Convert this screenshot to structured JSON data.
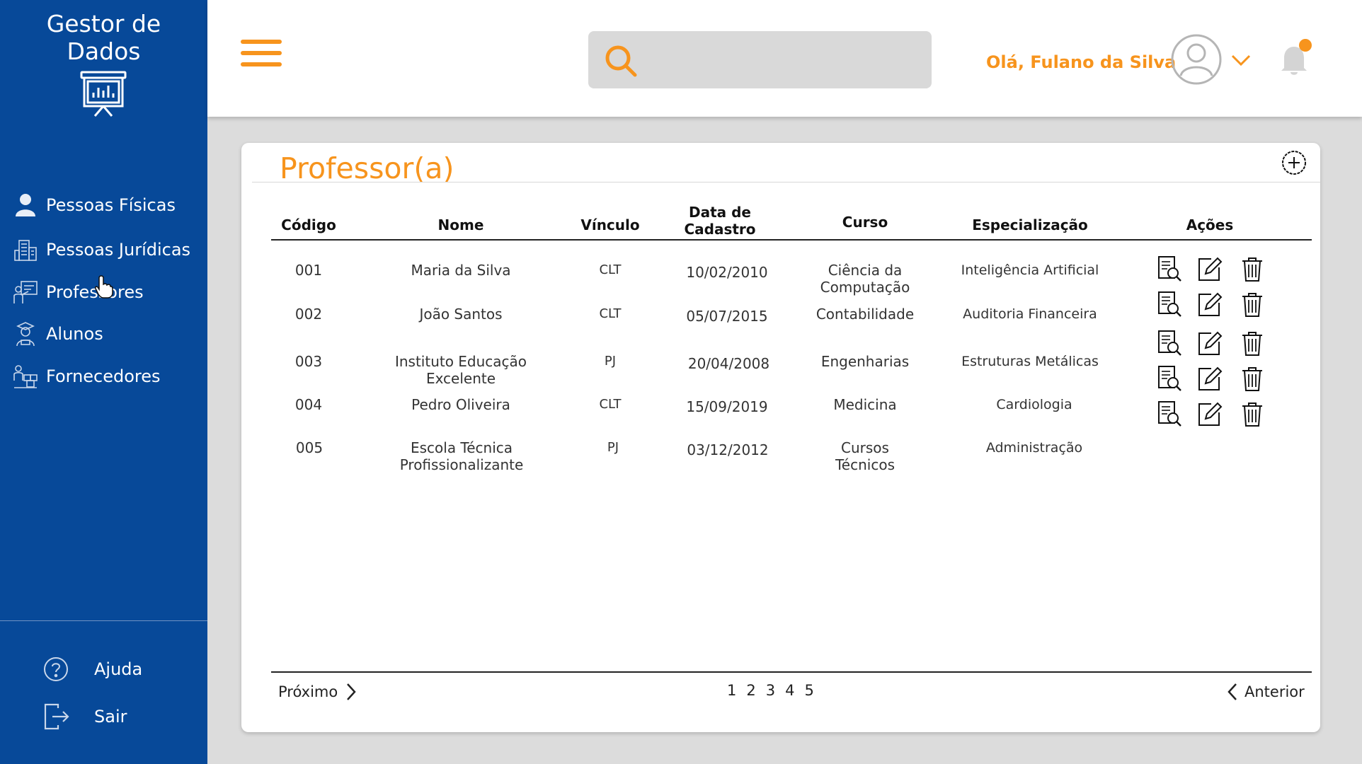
{
  "sidebar": {
    "brand": "Gestor de Dados",
    "items": [
      {
        "label": "Pessoas Físicas",
        "icon": "person-icon"
      },
      {
        "label": "Pessoas Jurídicas",
        "icon": "building-icon"
      },
      {
        "label": "Professores",
        "icon": "teacher-board-icon"
      },
      {
        "label": "Alunos",
        "icon": "student-icon"
      },
      {
        "label": "Fornecedores",
        "icon": "supplier-icon"
      }
    ],
    "bottom": [
      {
        "label": "Ajuda",
        "icon": "help-icon"
      },
      {
        "label": "Sair",
        "icon": "logout-icon"
      }
    ]
  },
  "header": {
    "search": {
      "placeholder": "",
      "value": ""
    },
    "greeting": "Olá, Fulano da Silva"
  },
  "card": {
    "title": "Professor(a)",
    "columns": [
      "Código",
      "Nome",
      "Vínculo",
      "Data de Cadastro",
      "Curso",
      "Especialização",
      "Ações"
    ],
    "rows": [
      {
        "codigo": "001",
        "nome": "Maria da Silva",
        "vinculo": "CLT",
        "data": "10/02/2010",
        "curso": "Ciência da Computação",
        "especializacao": "Inteligência Artificial"
      },
      {
        "codigo": "002",
        "nome": "João Santos",
        "vinculo": "CLT",
        "data": "05/07/2015",
        "curso": "Contabilidade",
        "especializacao": "Auditoria Financeira"
      },
      {
        "codigo": "003",
        "nome": "Instituto Educação Excelente",
        "vinculo": "PJ",
        "data": "20/04/2008",
        "curso": "Engenharias",
        "especializacao": "Estruturas Metálicas"
      },
      {
        "codigo": "004",
        "nome": "Pedro Oliveira",
        "vinculo": "CLT",
        "data": "15/09/2019",
        "curso": "Medicina",
        "especializacao": "Cardiologia"
      },
      {
        "codigo": "005",
        "nome": "Escola Técnica Profissionalizante",
        "vinculo": "PJ",
        "data": "03/12/2012",
        "curso": "Cursos Técnicos",
        "especializacao": "Administração"
      }
    ],
    "pagination": {
      "next_label": "Próximo",
      "pages": [
        "1",
        "2",
        "3",
        "4",
        "5"
      ],
      "prev_label": "Anterior"
    }
  },
  "colors": {
    "sidebar": "#074999",
    "accent": "#f7941d",
    "background": "#dcdcdc"
  }
}
